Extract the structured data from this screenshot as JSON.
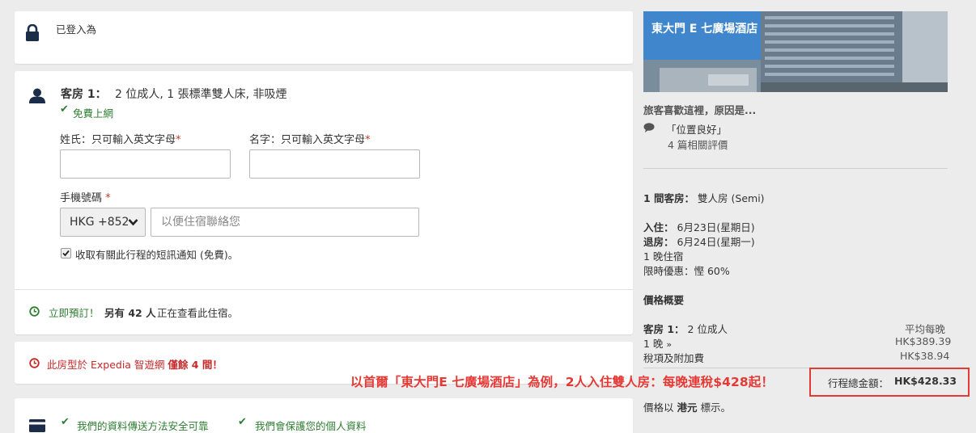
{
  "login": {
    "label": "已登入為"
  },
  "room": {
    "title": "客房 1：",
    "desc": "2 位成人, 1 張標準雙人床, 非吸煙",
    "wifi": "免費上網"
  },
  "form": {
    "surname_label": "姓氏：只可輸入英文字母",
    "given_label": "名字：只可輸入英文字母",
    "required_mark": "*",
    "phone_label": "手機號碼",
    "country_code": "HKG +852",
    "phone_placeholder": "以便住宿聯絡您",
    "sms_label": "收取有關此行程的短訊通知 (免費)。",
    "sms_checked": true
  },
  "urgency": {
    "book_now": "立即預訂！",
    "viewers_bold": "另有 42 人",
    "viewers_rest": "正在查看此住宿。"
  },
  "warning": {
    "text_before": "此房型於 Expedia 智遊網",
    "text_bold": "僅餘 4 間！"
  },
  "secure": {
    "item1": "我們的資料傳送方法安全可靠",
    "item2": "我們會保護您的個人資料"
  },
  "hotel": {
    "name": "東大門 E 七廣場酒店",
    "reason_header": "旅客喜歡這裡，原因是...",
    "reason": "「位置良好」",
    "reviews": "4 篇相關評價"
  },
  "booking": {
    "room_label": "1 間客房：",
    "room_value": "雙人房 (Semi)",
    "checkin_label": "入住：",
    "checkin_value": "6月23日(星期日)",
    "checkout_label": "退房：",
    "checkout_value": "6月24日(星期一)",
    "nights": "1 晚住宿",
    "deal": "限時優惠：慳 60%"
  },
  "price": {
    "header": "價格概要",
    "room_line_label": "客房 1：",
    "room_line_value": "2 位成人",
    "avg_label": "平均每晚",
    "nights_link": "1 晚",
    "chevron": "»",
    "nightly_price": "HK$389.39",
    "taxes_link": "稅項及附加費",
    "taxes_price": "HK$38.94",
    "total_label": "行程總金額：",
    "total_value": "HK$428.33",
    "currency_note_before": "價格以",
    "currency_note_bold": "港元",
    "currency_note_after": "標示。"
  },
  "promo_banner": "以首爾「東大門E 七廣場酒店」為例，2人入住雙人房：每晚連稅$428起！",
  "colors": {
    "navy": "#1b2d48",
    "green": "#2e7d32",
    "red": "#c62828",
    "link_blue": "#1e6bb8",
    "highlight_red": "#e53935"
  }
}
